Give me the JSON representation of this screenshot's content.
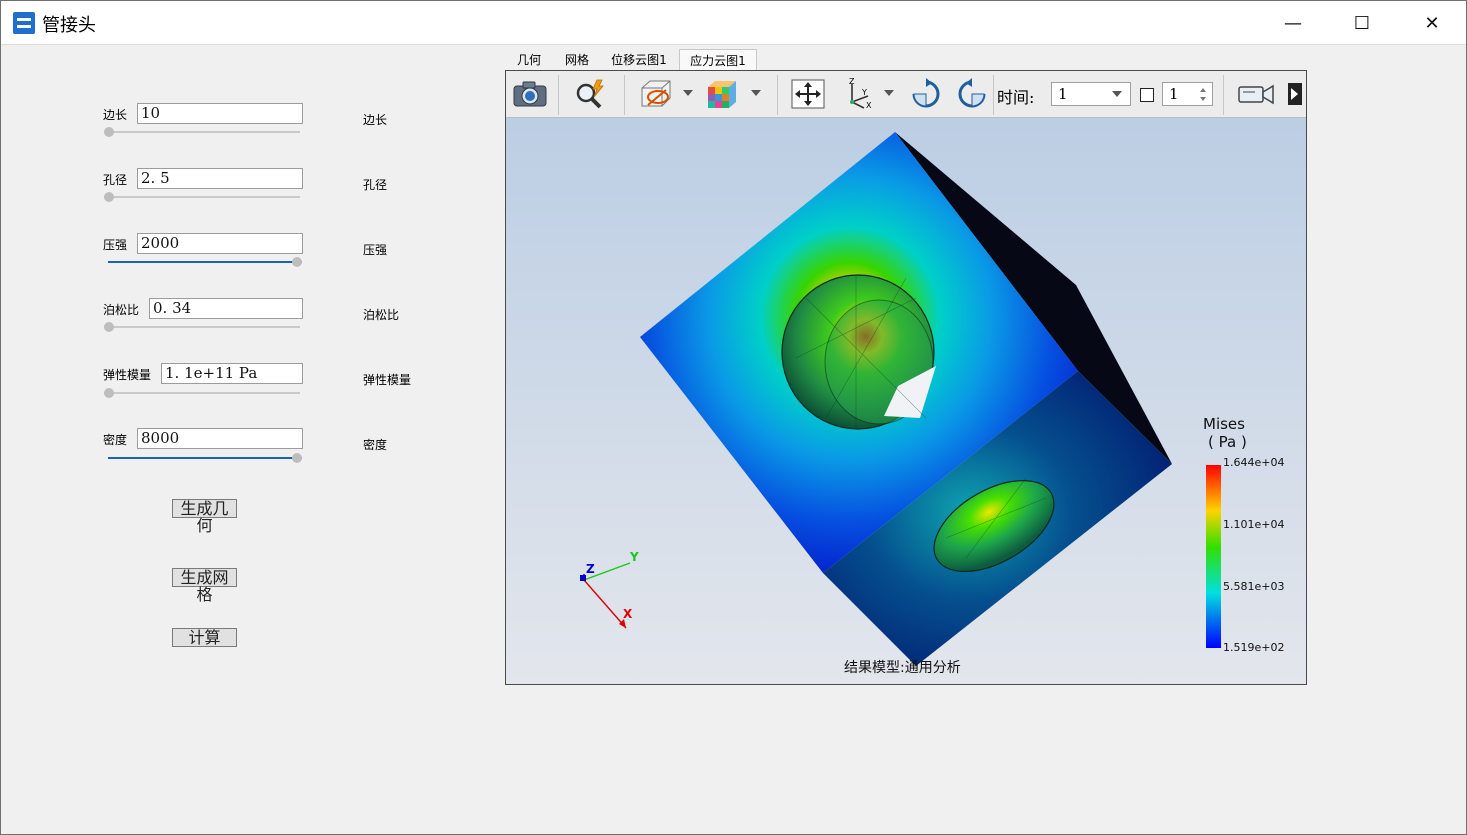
{
  "window": {
    "title": "管接头",
    "minimize": "—",
    "maximize": "☐",
    "close": "✕"
  },
  "params": [
    {
      "label": "边长",
      "value": "10",
      "right_label": "边长",
      "level": 0.0
    },
    {
      "label": "孔径",
      "value": "2. 5",
      "right_label": "孔径",
      "level": 0.0
    },
    {
      "label": "压强",
      "value": "2000",
      "right_label": "压强",
      "level": 1.0
    },
    {
      "label": "泊松比",
      "value": "0. 34",
      "right_label": "泊松比",
      "level": 0.0
    },
    {
      "label": "弹性模量",
      "value": "1. 1e+11  Pa",
      "right_label": "弹性模量",
      "level": 0.0
    },
    {
      "label": "密度",
      "value": "8000",
      "right_label": "密度",
      "level": 1.0
    }
  ],
  "buttons": {
    "gen_geometry": "生成几何",
    "gen_mesh": "生成网格",
    "compute": "计算"
  },
  "tabs": [
    "几何",
    "网格",
    "位移云图1",
    "应力云图1"
  ],
  "active_tab": "应力云图1",
  "toolbar": {
    "time_label": "时间:",
    "time_value": "1",
    "spin_value": "1"
  },
  "legend": {
    "title": "Mises",
    "unit": "( Pa )",
    "values": [
      "1.644e+04",
      "1.101e+04",
      "5.581e+03",
      "1.519e+02"
    ]
  },
  "axes": {
    "x": "X",
    "y": "Y",
    "z": "Z"
  },
  "footer": "结果模型:通用分析",
  "colors": {
    "accent": "#1b61b4",
    "max": "#ff0000",
    "min": "#0000ff"
  }
}
